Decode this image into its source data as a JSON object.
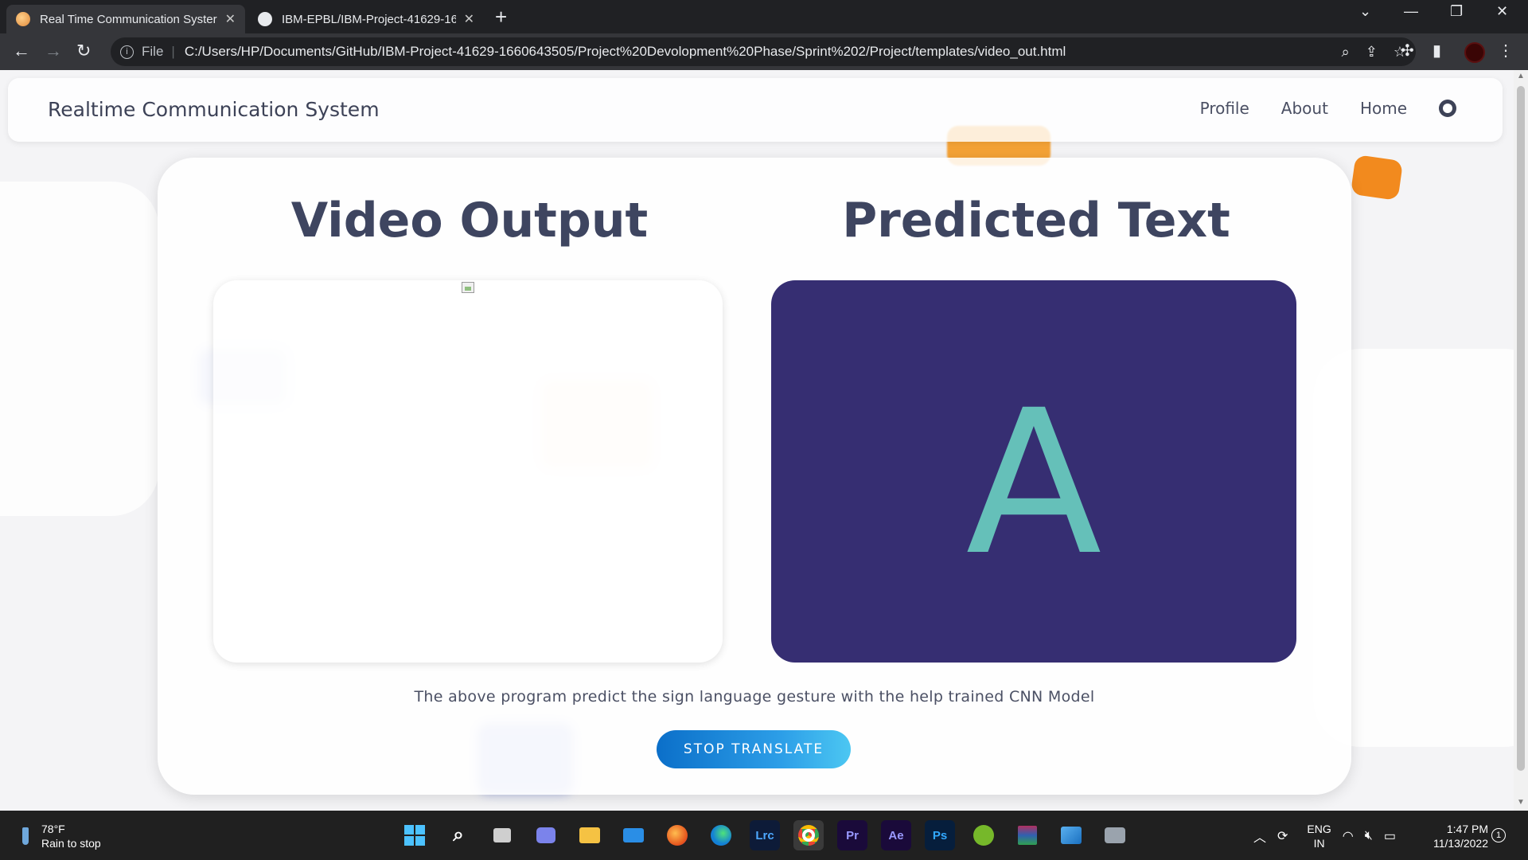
{
  "browser": {
    "tabs": [
      {
        "title": "Real Time Communication Syster",
        "active": true
      },
      {
        "title": "IBM-EPBL/IBM-Project-41629-16",
        "active": false
      }
    ],
    "new_tab": "+",
    "address": {
      "scheme_label": "File",
      "url": "C:/Users/HP/Documents/GitHub/IBM-Project-41629-1660643505/Project%20Devolopment%20Phase/Sprint%202/Project/templates/video_out.html"
    }
  },
  "navbar": {
    "brand": "Realtime Communication System",
    "links": [
      "Profile",
      "About",
      "Home"
    ],
    "github_icon": "github-icon"
  },
  "main": {
    "video_heading": "Video Output",
    "predicted_heading": "Predicted Text",
    "predicted_value": "A",
    "caption": "The above program predict the sign language gesture with the help trained CNN Model",
    "stop_button": "STOP TRANSLATE"
  },
  "taskbar": {
    "weather_temp": "78°F",
    "weather_desc": "Rain to stop",
    "apps": [
      "start",
      "search",
      "task-view",
      "teams",
      "file-explorer",
      "mail",
      "firefox",
      "edge",
      "Lrc",
      "chrome",
      "Pr",
      "Ae",
      "Ps",
      "utorrent",
      "winrar",
      "photos",
      "camera"
    ],
    "lang_line1": "ENG",
    "lang_line2": "IN",
    "time": "1:47 PM",
    "date": "11/13/2022",
    "notification_count": "1"
  },
  "colors": {
    "predicted_bg": "#362e72",
    "predicted_letter": "#65c0b9",
    "heading": "#3e4560",
    "button_start": "#0b6fc9",
    "button_end": "#4cc7f2"
  }
}
